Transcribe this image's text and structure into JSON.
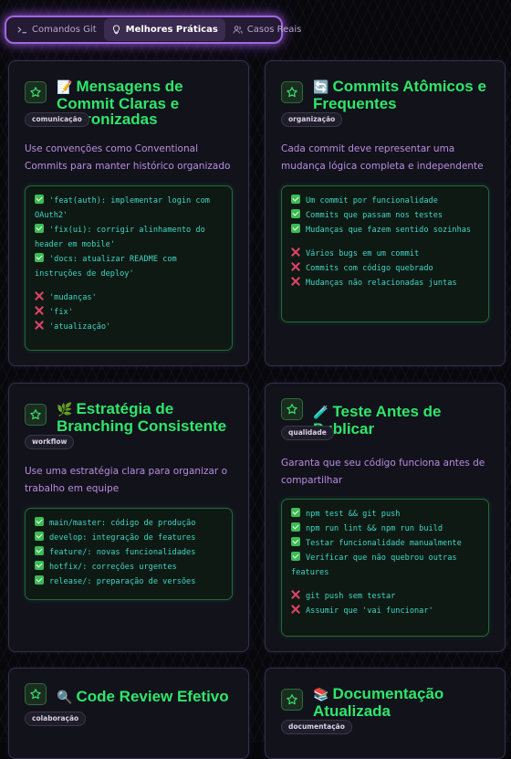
{
  "tabs": [
    {
      "label": "Comandos Git",
      "icon": "terminal-icon",
      "active": false
    },
    {
      "label": "Melhores Práticas",
      "icon": "lightbulb-icon",
      "active": true
    },
    {
      "label": "Casos Reais",
      "icon": "users-icon",
      "active": false
    }
  ],
  "cards": [
    {
      "emoji": "📝",
      "title": "Mensagens de Commit Claras e Padronizadas",
      "tag": "comunicação",
      "description": "Use convenções como Conventional Commits para manter histórico organizado",
      "good": [
        "'feat(auth): implementar login com OAuth2'",
        "'fix(ui): corrigir alinhamento do header em mobile'",
        "'docs: atualizar README com instruções de deploy'"
      ],
      "bad": [
        "'mudanças'",
        "'fix'",
        "'atualização'"
      ]
    },
    {
      "emoji": "🔄",
      "title": "Commits Atômicos e Frequentes",
      "tag": "organização",
      "description": "Cada commit deve representar uma mudança lógica completa e independente",
      "good": [
        "Um commit por funcionalidade",
        "Commits que passam nos testes",
        "Mudanças que fazem sentido sozinhas"
      ],
      "bad": [
        "Vários bugs em um commit",
        "Commits com código quebrado",
        "Mudanças não relacionadas juntas"
      ]
    },
    {
      "emoji": "🌿",
      "title": "Estratégia de Branching Consistente",
      "tag": "workflow",
      "description": "Use uma estratégia clara para organizar o trabalho em equipe",
      "good": [
        "main/master: código de produção",
        "develop: integração de features",
        "feature/: novas funcionalidades",
        "hotfix/: correções urgentes",
        "release/: preparação de versões"
      ],
      "bad": []
    },
    {
      "emoji": "🧪",
      "title": "Teste Antes de Publicar",
      "tag": "qualidade",
      "description": "Garanta que seu código funciona antes de compartilhar",
      "good": [
        "npm test && git push",
        "npm run lint && npm run build",
        "Testar funcionalidade manualmente",
        "Verificar que não quebrou outras features"
      ],
      "bad": [
        "git push sem testar",
        "Assumir que 'vai funcionar'"
      ]
    },
    {
      "emoji": "🔍",
      "title": "Code Review Efetivo",
      "tag": "colaboração",
      "description": "",
      "good": [],
      "bad": []
    },
    {
      "emoji": "📚",
      "title": "Documentação Atualizada",
      "tag": "documentação",
      "description": "",
      "good": [],
      "bad": []
    }
  ],
  "colors": {
    "accent_green": "#2fe66a",
    "tab_glow": "#a066e0",
    "desc_purple": "#b98de0",
    "code_cyan": "#3fd7c4"
  }
}
